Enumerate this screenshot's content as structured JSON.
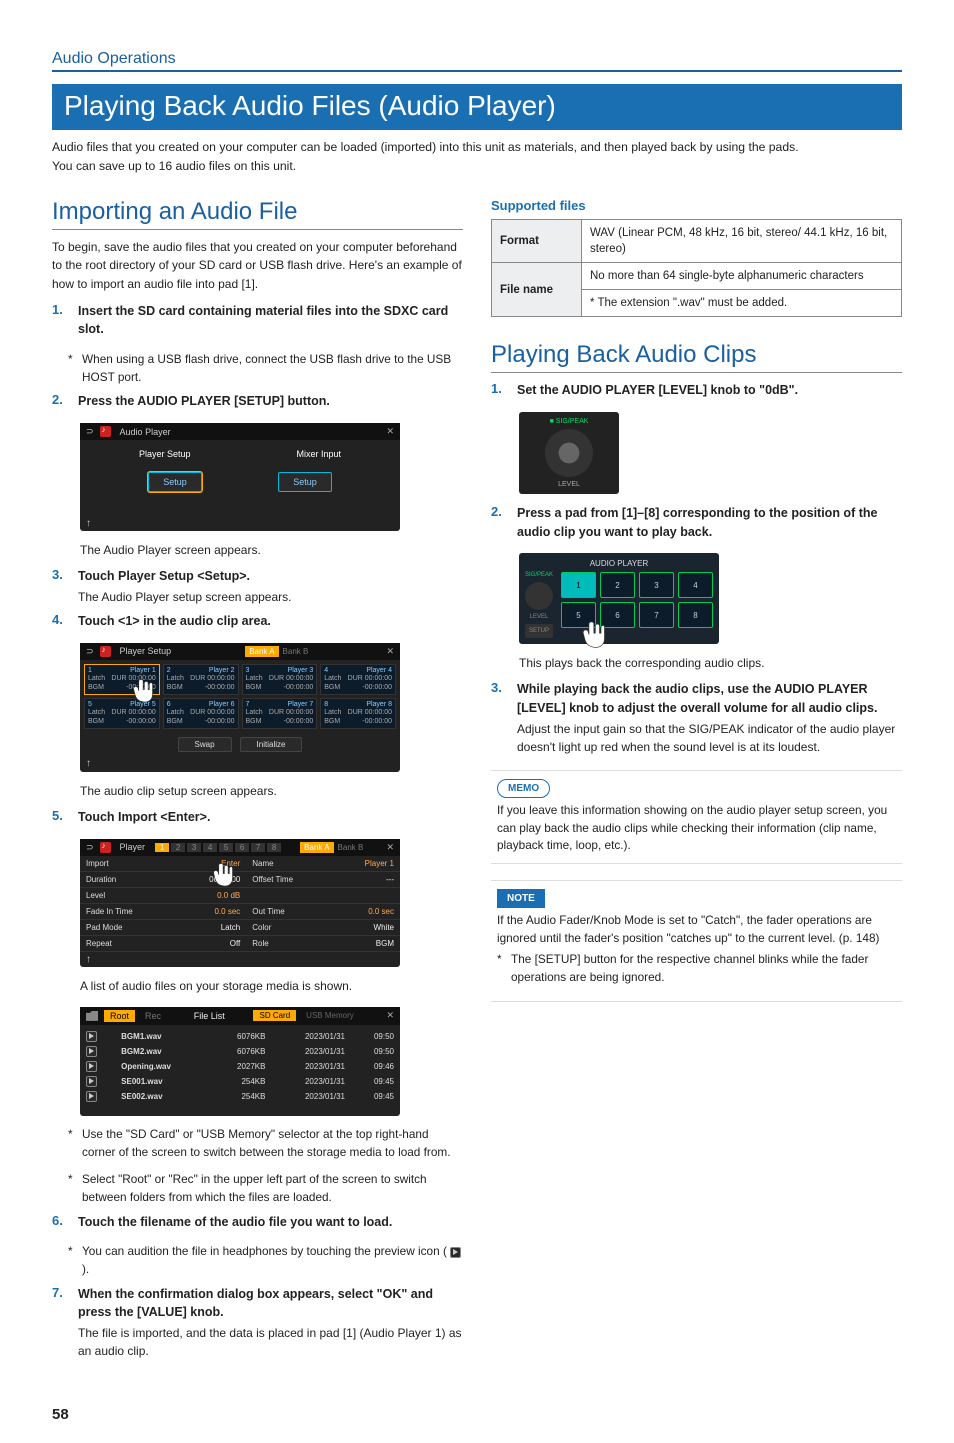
{
  "header": {
    "section": "Audio Operations"
  },
  "title": "Playing Back Audio Files (Audio Player)",
  "intro1": "Audio files that you created on your computer can be loaded (imported) into this unit as materials, and then played back by using the pads.",
  "intro2": "You can save up to 16 audio files on this unit.",
  "import": {
    "heading": "Importing an Audio File",
    "lead": "To begin, save the audio files that you created on your computer beforehand to the root directory of your SD card or USB flash drive. Here's an example of how to import an audio file into pad [1].",
    "s1": "Insert the SD card containing material files into the SDXC card slot.",
    "s1note": "When using a USB flash drive, connect the USB flash drive to the USB HOST port.",
    "s2": "Press the AUDIO PLAYER [SETUP] button.",
    "s2cap": "The Audio Player screen appears.",
    "s3": "Touch Player Setup <Setup>.",
    "s3cap": "The Audio Player setup screen appears.",
    "s4": "Touch <1> in the audio clip area.",
    "s4cap": "The audio clip setup screen appears.",
    "s5": "Touch Import <Enter>.",
    "s5cap": "A list of audio files on your storage media is shown.",
    "note_sd": "Use the \"SD Card\" or \"USB Memory\" selector at the top right-hand corner of the screen to switch between the storage media to load from.",
    "note_root": "Select \"Root\" or \"Rec\" in the upper left part of the screen to switch between folders from which the files are loaded.",
    "s6": "Touch the filename of the audio file you want to load.",
    "s6note": "You can audition the file in headphones by touching the preview icon (",
    "s6note_end": ").",
    "s7": "When the confirmation dialog box appears, select \"OK\" and press the [VALUE] knob.",
    "s7cap": "The file is imported, and the data is placed in pad [1] (Audio Player 1) as an audio clip."
  },
  "shot1": {
    "title": "Audio Player",
    "tab1": "Player Setup",
    "tab2": "Mixer Input",
    "btn": "Setup"
  },
  "shot2": {
    "title": "Player Setup",
    "banka": "Bank A",
    "bankb": "Bank B",
    "pads": [
      {
        "n": "1",
        "name": "Player 1",
        "m": "Latch",
        "d": "DUR 00:00:00",
        "b": "BGM",
        "t": "-00:00:00"
      },
      {
        "n": "2",
        "name": "Player 2",
        "m": "Latch",
        "d": "DUR 00:00:00",
        "b": "BGM",
        "t": "-00:00:00"
      },
      {
        "n": "3",
        "name": "Player 3",
        "m": "Latch",
        "d": "DUR 00:00:00",
        "b": "BGM",
        "t": "-00:00:00"
      },
      {
        "n": "4",
        "name": "Player 4",
        "m": "Latch",
        "d": "DUR 00:00:00",
        "b": "BGM",
        "t": "-00:00:00"
      },
      {
        "n": "5",
        "name": "Player 5",
        "m": "Latch",
        "d": "DUR 00:00:00",
        "b": "BGM",
        "t": "-00:00:00"
      },
      {
        "n": "6",
        "name": "Player 6",
        "m": "Latch",
        "d": "DUR 00:00:00",
        "b": "BGM",
        "t": "-00:00:00"
      },
      {
        "n": "7",
        "name": "Player 7",
        "m": "Latch",
        "d": "DUR 00:00:00",
        "b": "BGM",
        "t": "-00:00:00"
      },
      {
        "n": "8",
        "name": "Player 8",
        "m": "Latch",
        "d": "DUR 00:00:00",
        "b": "BGM",
        "t": "-00:00:00"
      }
    ],
    "swap": "Swap",
    "init": "Initialize"
  },
  "shot3": {
    "title": "Player",
    "banka": "Bank A",
    "bankb": "Bank B",
    "rows": [
      {
        "l": "Import",
        "v": "Enter",
        "r1": "Name",
        "r2": "Player 1"
      },
      {
        "l": "Duration",
        "v": "00:00:00",
        "r1": "Offset Time",
        "r2": "---"
      },
      {
        "l": "Level",
        "v": "0.0 dB",
        "r1": "",
        "r2": ""
      },
      {
        "l": "Fade In Time",
        "v": "0.0 sec",
        "r1": "Out Time",
        "r2": "0.0 sec"
      },
      {
        "l": "Pad Mode",
        "v": "Latch",
        "r1": "Color",
        "r2": "White"
      },
      {
        "l": "Repeat",
        "v": "Off",
        "r1": "Role",
        "r2": "BGM"
      }
    ]
  },
  "shot4": {
    "root": "Root",
    "rec": "Rec",
    "filelist": "File List",
    "sd": "SD Card",
    "usb": "USB Memory",
    "files": [
      {
        "n": "BGM1.wav",
        "s": "6076KB",
        "d": "2023/01/31",
        "t": "09:50"
      },
      {
        "n": "BGM2.wav",
        "s": "6076KB",
        "d": "2023/01/31",
        "t": "09:50"
      },
      {
        "n": "Opening.wav",
        "s": "2027KB",
        "d": "2023/01/31",
        "t": "09:46"
      },
      {
        "n": "SE001.wav",
        "s": "254KB",
        "d": "2023/01/31",
        "t": "09:45"
      },
      {
        "n": "SE002.wav",
        "s": "254KB",
        "d": "2023/01/31",
        "t": "09:45"
      }
    ]
  },
  "supported": {
    "heading": "Supported files",
    "format_h": "Format",
    "format_v": "WAV (Linear PCM, 48 kHz, 16 bit, stereo/ 44.1 kHz, 16 bit, stereo)",
    "file_h": "File name",
    "file_v1": "No more than 64 single-byte alphanumeric characters",
    "file_v2": "* The extension \".wav\" must be added."
  },
  "playback": {
    "heading": "Playing Back Audio Clips",
    "s1": "Set the AUDIO PLAYER [LEVEL] knob to \"0dB\".",
    "s2": "Press a pad from [1]–[8] corresponding to the position of the audio clip you want to play back.",
    "s2cap": "This plays back the corresponding audio clips.",
    "s3": "While playing back the audio clips, use the AUDIO PLAYER [LEVEL] knob to adjust the overall volume for all audio clips.",
    "s3cap": "Adjust the input gain so that the SIG/PEAK indicator of the audio player doesn't light up red when the sound level is at its loudest."
  },
  "ap_shot": {
    "title": "AUDIO PLAYER",
    "sig": "SIG/PEAK",
    "level": "LEVEL",
    "setup": "SETUP"
  },
  "memo": {
    "tag": "MEMO",
    "body": "If you leave this information showing on the audio player setup screen, you can play back the audio clips while checking their information (clip name, playback time, loop, etc.)."
  },
  "note": {
    "tag": "NOTE",
    "body": "If the Audio Fader/Knob Mode is set to \"Catch\", the fader operations are ignored until the fader's position \"catches up\" to the current level. (p. 148)",
    "sub": "The [SETUP] button for the respective channel blinks while the fader operations are being ignored."
  },
  "page": "58"
}
